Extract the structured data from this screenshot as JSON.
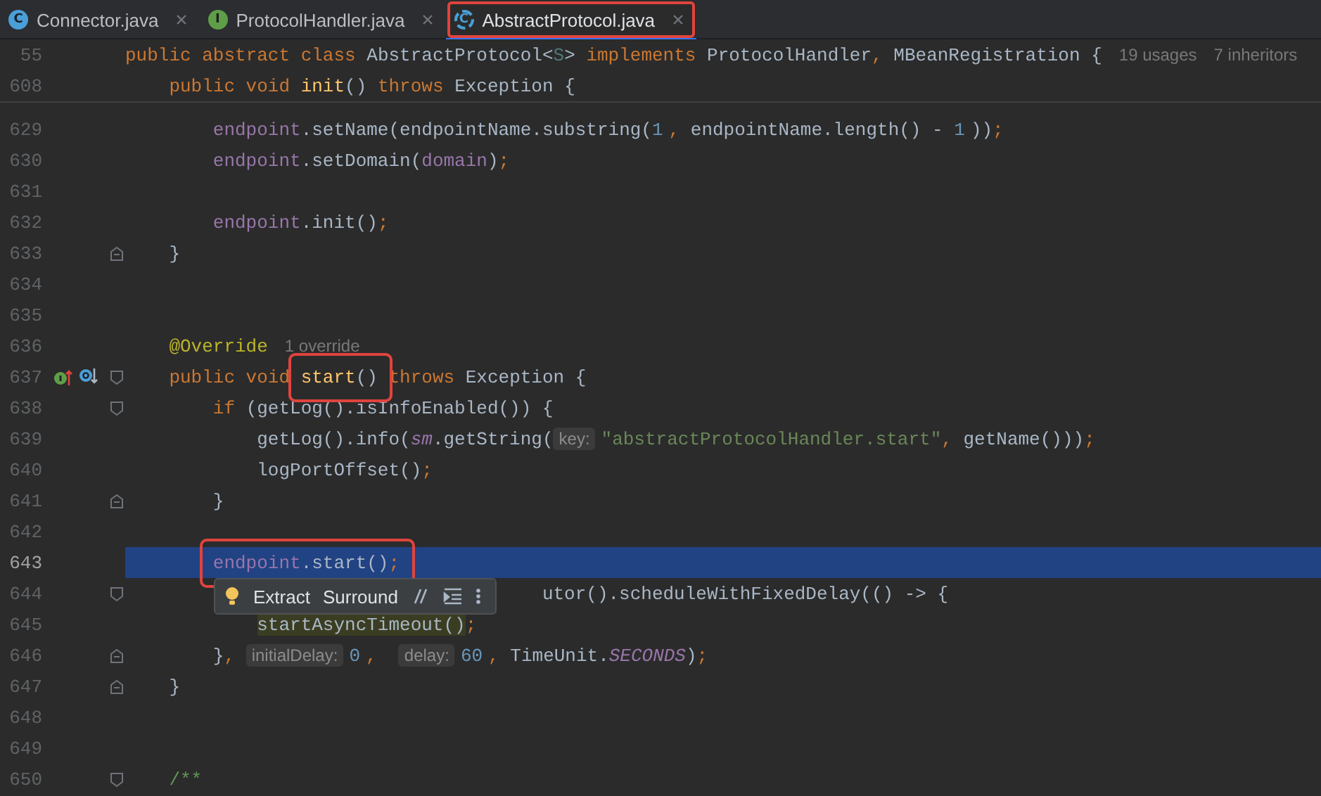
{
  "tabs": [
    {
      "label": "Connector.java",
      "kind": "class",
      "icon_letter": "C",
      "selected": false,
      "outlined": false
    },
    {
      "label": "ProtocolHandler.java",
      "kind": "interface",
      "icon_letter": "I",
      "selected": false,
      "outlined": false
    },
    {
      "label": "AbstractProtocol.java",
      "kind": "abstract",
      "icon_letter": "C",
      "selected": true,
      "outlined": true
    }
  ],
  "sticky_lines": [
    {
      "number": "55",
      "tokens": [
        {
          "t": "public abstract class ",
          "kind": "kw"
        },
        {
          "t": "AbstractProtocol<",
          "kind": "id"
        },
        {
          "t": "S",
          "kind": "tparam"
        },
        {
          "t": "> ",
          "kind": "id"
        },
        {
          "t": "implements ",
          "kind": "kw"
        },
        {
          "t": "ProtocolHandler",
          "kind": "id"
        },
        {
          "t": ",",
          "kind": "kw"
        },
        {
          "t": " MBeanRegistration {",
          "kind": "id"
        }
      ],
      "hints": [
        "19 usages",
        "7 inheritors"
      ]
    },
    {
      "number": "608",
      "tokens": [
        {
          "t": "    public void ",
          "kind": "kw"
        },
        {
          "t": "init",
          "kind": "fn"
        },
        {
          "t": "() ",
          "kind": "id"
        },
        {
          "t": "throws ",
          "kind": "kw"
        },
        {
          "t": "Exception {",
          "kind": "id"
        }
      ]
    }
  ],
  "lines": [
    {
      "number": "629",
      "current": false,
      "tokens": [
        {
          "t": "        endpoint",
          "kind": "field"
        },
        {
          "t": ".setName(endpointName.substring(",
          "kind": "id"
        },
        {
          "t": "1",
          "kind": "num"
        },
        {
          "t": ", ",
          "kind": "kw"
        },
        {
          "t": "endpointName.length() - ",
          "kind": "id"
        },
        {
          "t": "1",
          "kind": "num"
        },
        {
          "t": "))",
          "kind": "id"
        },
        {
          "t": ";",
          "kind": "kw"
        }
      ]
    },
    {
      "number": "630",
      "current": false,
      "tokens": [
        {
          "t": "        endpoint",
          "kind": "field"
        },
        {
          "t": ".setDomain(",
          "kind": "id"
        },
        {
          "t": "domain",
          "kind": "field"
        },
        {
          "t": ")",
          "kind": "id"
        },
        {
          "t": ";",
          "kind": "kw"
        }
      ]
    },
    {
      "number": "631",
      "current": false
    },
    {
      "number": "632",
      "current": false,
      "tokens": [
        {
          "t": "        endpoint",
          "kind": "field"
        },
        {
          "t": ".init()",
          "kind": "id"
        },
        {
          "t": ";",
          "kind": "kw"
        }
      ]
    },
    {
      "number": "633",
      "current": false,
      "fold_marker": {
        "kind": "end"
      },
      "tokens": [
        {
          "t": "    }",
          "kind": "id"
        }
      ]
    },
    {
      "number": "634",
      "current": false
    },
    {
      "number": "635",
      "current": false
    },
    {
      "number": "636",
      "current": false,
      "tokens": [
        {
          "t": "    @Override",
          "kind": "ann"
        }
      ],
      "hints": [
        "1 override"
      ]
    },
    {
      "number": "637",
      "current": false,
      "fold_marker": {
        "kind": "start"
      },
      "markers": [
        {
          "kind": "implements"
        },
        {
          "kind": "overridden"
        }
      ],
      "tokens": [
        {
          "t": "    public void ",
          "kind": "kw"
        },
        {
          "t": "start",
          "kind": "fn",
          "boxed": true
        },
        {
          "t": "()",
          "kind": "id",
          "boxed": true
        },
        {
          "t": " throws ",
          "kind": "kw"
        },
        {
          "t": "Exception {",
          "kind": "id"
        }
      ]
    },
    {
      "number": "638",
      "current": false,
      "fold_marker": {
        "kind": "start"
      },
      "tokens": [
        {
          "t": "        if ",
          "kind": "kw"
        },
        {
          "t": "(getLog().isInfoEnabled()) {",
          "kind": "id"
        }
      ]
    },
    {
      "number": "639",
      "current": false,
      "tokens": [
        {
          "t": "            getLog().info(",
          "kind": "id"
        },
        {
          "t": "sm",
          "kind": "sfield"
        },
        {
          "t": ".getString(",
          "kind": "id"
        },
        {
          "t": "key:",
          "kind": "hint"
        },
        {
          "t": "\"abstractProtocolHandler.start\"",
          "kind": "str"
        },
        {
          "t": ",",
          "kind": "kw"
        },
        {
          "t": " getName()))",
          "kind": "id"
        },
        {
          "t": ";",
          "kind": "kw"
        }
      ]
    },
    {
      "number": "640",
      "current": false,
      "tokens": [
        {
          "t": "            logPortOffset()",
          "kind": "id"
        },
        {
          "t": ";",
          "kind": "kw"
        }
      ]
    },
    {
      "number": "641",
      "current": false,
      "fold_marker": {
        "kind": "end"
      },
      "tokens": [
        {
          "t": "        }",
          "kind": "id"
        }
      ]
    },
    {
      "number": "642",
      "current": false
    },
    {
      "number": "643",
      "current": true,
      "tokens": [
        {
          "t": "        endpoint",
          "kind": "field",
          "boxed": true
        },
        {
          "t": ".start()",
          "kind": "id",
          "boxed": true
        },
        {
          "t": ";",
          "kind": "kw",
          "boxed": true
        }
      ]
    },
    {
      "number": "644",
      "current": false,
      "fold_marker": {
        "kind": "start"
      },
      "tokens": [
        {
          "t": "                                      utor().scheduleWithFixedDelay(() -> {",
          "kind": "id"
        }
      ]
    },
    {
      "number": "645",
      "current": false,
      "tokens": [
        {
          "t": "            startAsyncTimeout()",
          "kind": "mark"
        },
        {
          "t": ";",
          "kind": "kw"
        }
      ]
    },
    {
      "number": "646",
      "current": false,
      "fold_marker": {
        "kind": "end"
      },
      "tokens": [
        {
          "t": "        }",
          "kind": "id"
        },
        {
          "t": ", ",
          "kind": "kw"
        },
        {
          "t": "initialDelay:",
          "kind": "hint"
        },
        {
          "t": "0",
          "kind": "num"
        },
        {
          "t": ",  ",
          "kind": "kw"
        },
        {
          "t": "delay:",
          "kind": "hint"
        },
        {
          "t": "60",
          "kind": "num"
        },
        {
          "t": ",",
          "kind": "kw"
        },
        {
          "t": " TimeUnit.",
          "kind": "id"
        },
        {
          "t": "SECONDS",
          "kind": "static"
        },
        {
          "t": ")",
          "kind": "id"
        },
        {
          "t": ";",
          "kind": "kw"
        }
      ]
    },
    {
      "number": "647",
      "current": false,
      "fold_marker": {
        "kind": "end"
      },
      "tokens": [
        {
          "t": "    }",
          "kind": "id"
        }
      ]
    },
    {
      "number": "648",
      "current": false
    },
    {
      "number": "649",
      "current": false
    },
    {
      "number": "650",
      "current": false,
      "fold_marker": {
        "kind": "start"
      },
      "tokens": [
        {
          "t": "    /**",
          "kind": "comment"
        }
      ]
    }
  ],
  "popup": {
    "actions": [
      "Extract",
      "Surround"
    ]
  }
}
